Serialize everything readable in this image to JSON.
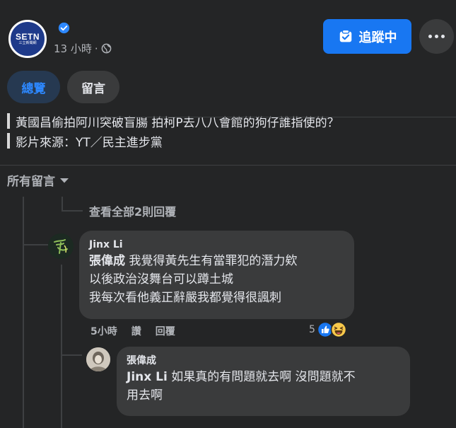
{
  "page": {
    "logo_text": "SETN",
    "logo_subtext": "三立新聞網",
    "time": "13 小時",
    "separator": "·"
  },
  "header": {
    "follow_label": "追蹤中"
  },
  "tabs": [
    {
      "label": "總覽",
      "active": true
    },
    {
      "label": "留言",
      "active": false
    }
  ],
  "post": {
    "lines": [
      "黃國昌偷拍阿川突破盲腸 拍柯P去八八會館的狗仔誰指使的？",
      "影片來源：YT／民主進步黨"
    ]
  },
  "comments_section": {
    "sort_label": "所有留言",
    "view_replies_label": "查看全部2則回覆"
  },
  "comments": [
    {
      "author": "Jinx Li",
      "mention": "張偉成",
      "lines": [
        "我覺得黃先生有當罪犯的潛力欸",
        "以後政治沒舞台可以蹲土城",
        "我每次看他義正辭嚴我都覺得很諷刺"
      ],
      "time": "5小時",
      "like_label": "讚",
      "reply_label": "回覆",
      "reaction_count": "5"
    },
    {
      "author": "張偉成",
      "mention": "Jinx Li",
      "lines": [
        "如果真的有問題就去啊 沒問題就不",
        "用去啊"
      ]
    }
  ],
  "colors": {
    "background": "#242526",
    "bubble": "#3a3b3c",
    "accent": "#1877f2",
    "secondary_text": "#b0b3b8"
  }
}
